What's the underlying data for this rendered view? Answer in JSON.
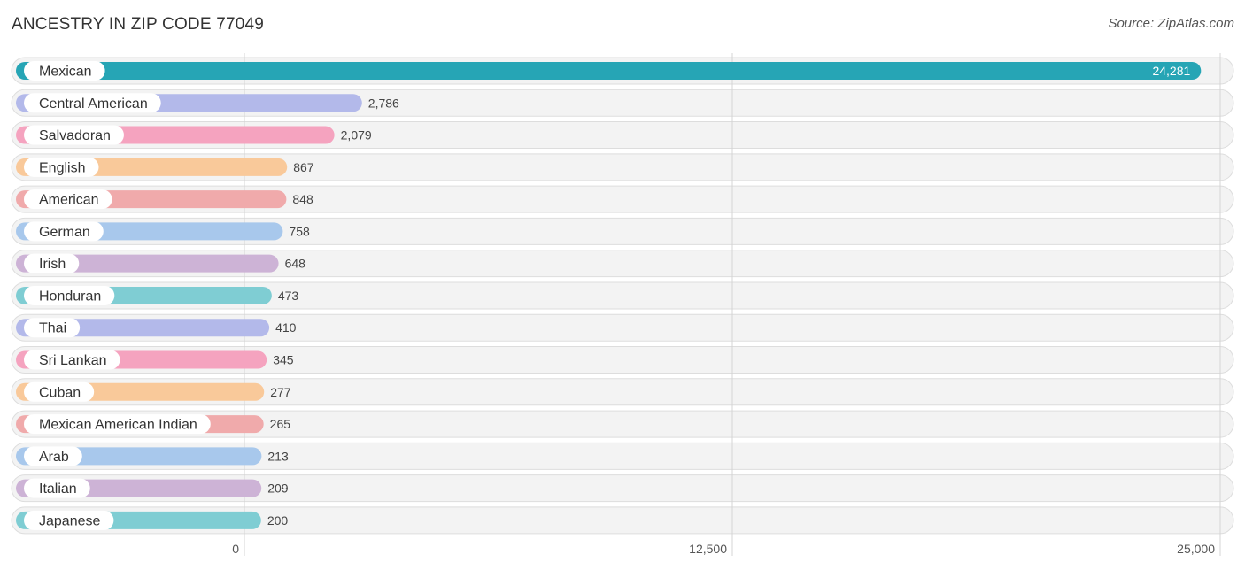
{
  "header": {
    "title": "ANCESTRY IN ZIP CODE 77049",
    "source": "Source: ZipAtlas.com"
  },
  "chart_data": {
    "type": "bar",
    "orientation": "horizontal",
    "title": "ANCESTRY IN ZIP CODE 77049",
    "xlabel": "",
    "ylabel": "",
    "xlim": [
      0,
      25000
    ],
    "grid": true,
    "ticks": [
      {
        "value": 0,
        "label": "0"
      },
      {
        "value": 12500,
        "label": "12,500"
      },
      {
        "value": 25000,
        "label": "25,000"
      }
    ],
    "categories": [
      "Mexican",
      "Central American",
      "Salvadoran",
      "English",
      "American",
      "German",
      "Irish",
      "Honduran",
      "Thai",
      "Sri Lankan",
      "Cuban",
      "Mexican American Indian",
      "Arab",
      "Italian",
      "Japanese"
    ],
    "values": [
      24281,
      2786,
      2079,
      867,
      848,
      758,
      648,
      473,
      410,
      345,
      277,
      265,
      213,
      209,
      200
    ],
    "value_labels": [
      "24,281",
      "2,786",
      "2,079",
      "867",
      "848",
      "758",
      "648",
      "473",
      "410",
      "345",
      "277",
      "265",
      "213",
      "209",
      "200"
    ],
    "colors": [
      "#26a5b5",
      "#b3b9ea",
      "#f5a3bf",
      "#f9c99a",
      "#f0aaab",
      "#a8c8ec",
      "#cdb3d6",
      "#7fcdd3",
      "#b3b9ea",
      "#f5a3bf",
      "#f9c99a",
      "#f0aaab",
      "#a8c8ec",
      "#cdb3d6",
      "#7fcdd3"
    ]
  }
}
